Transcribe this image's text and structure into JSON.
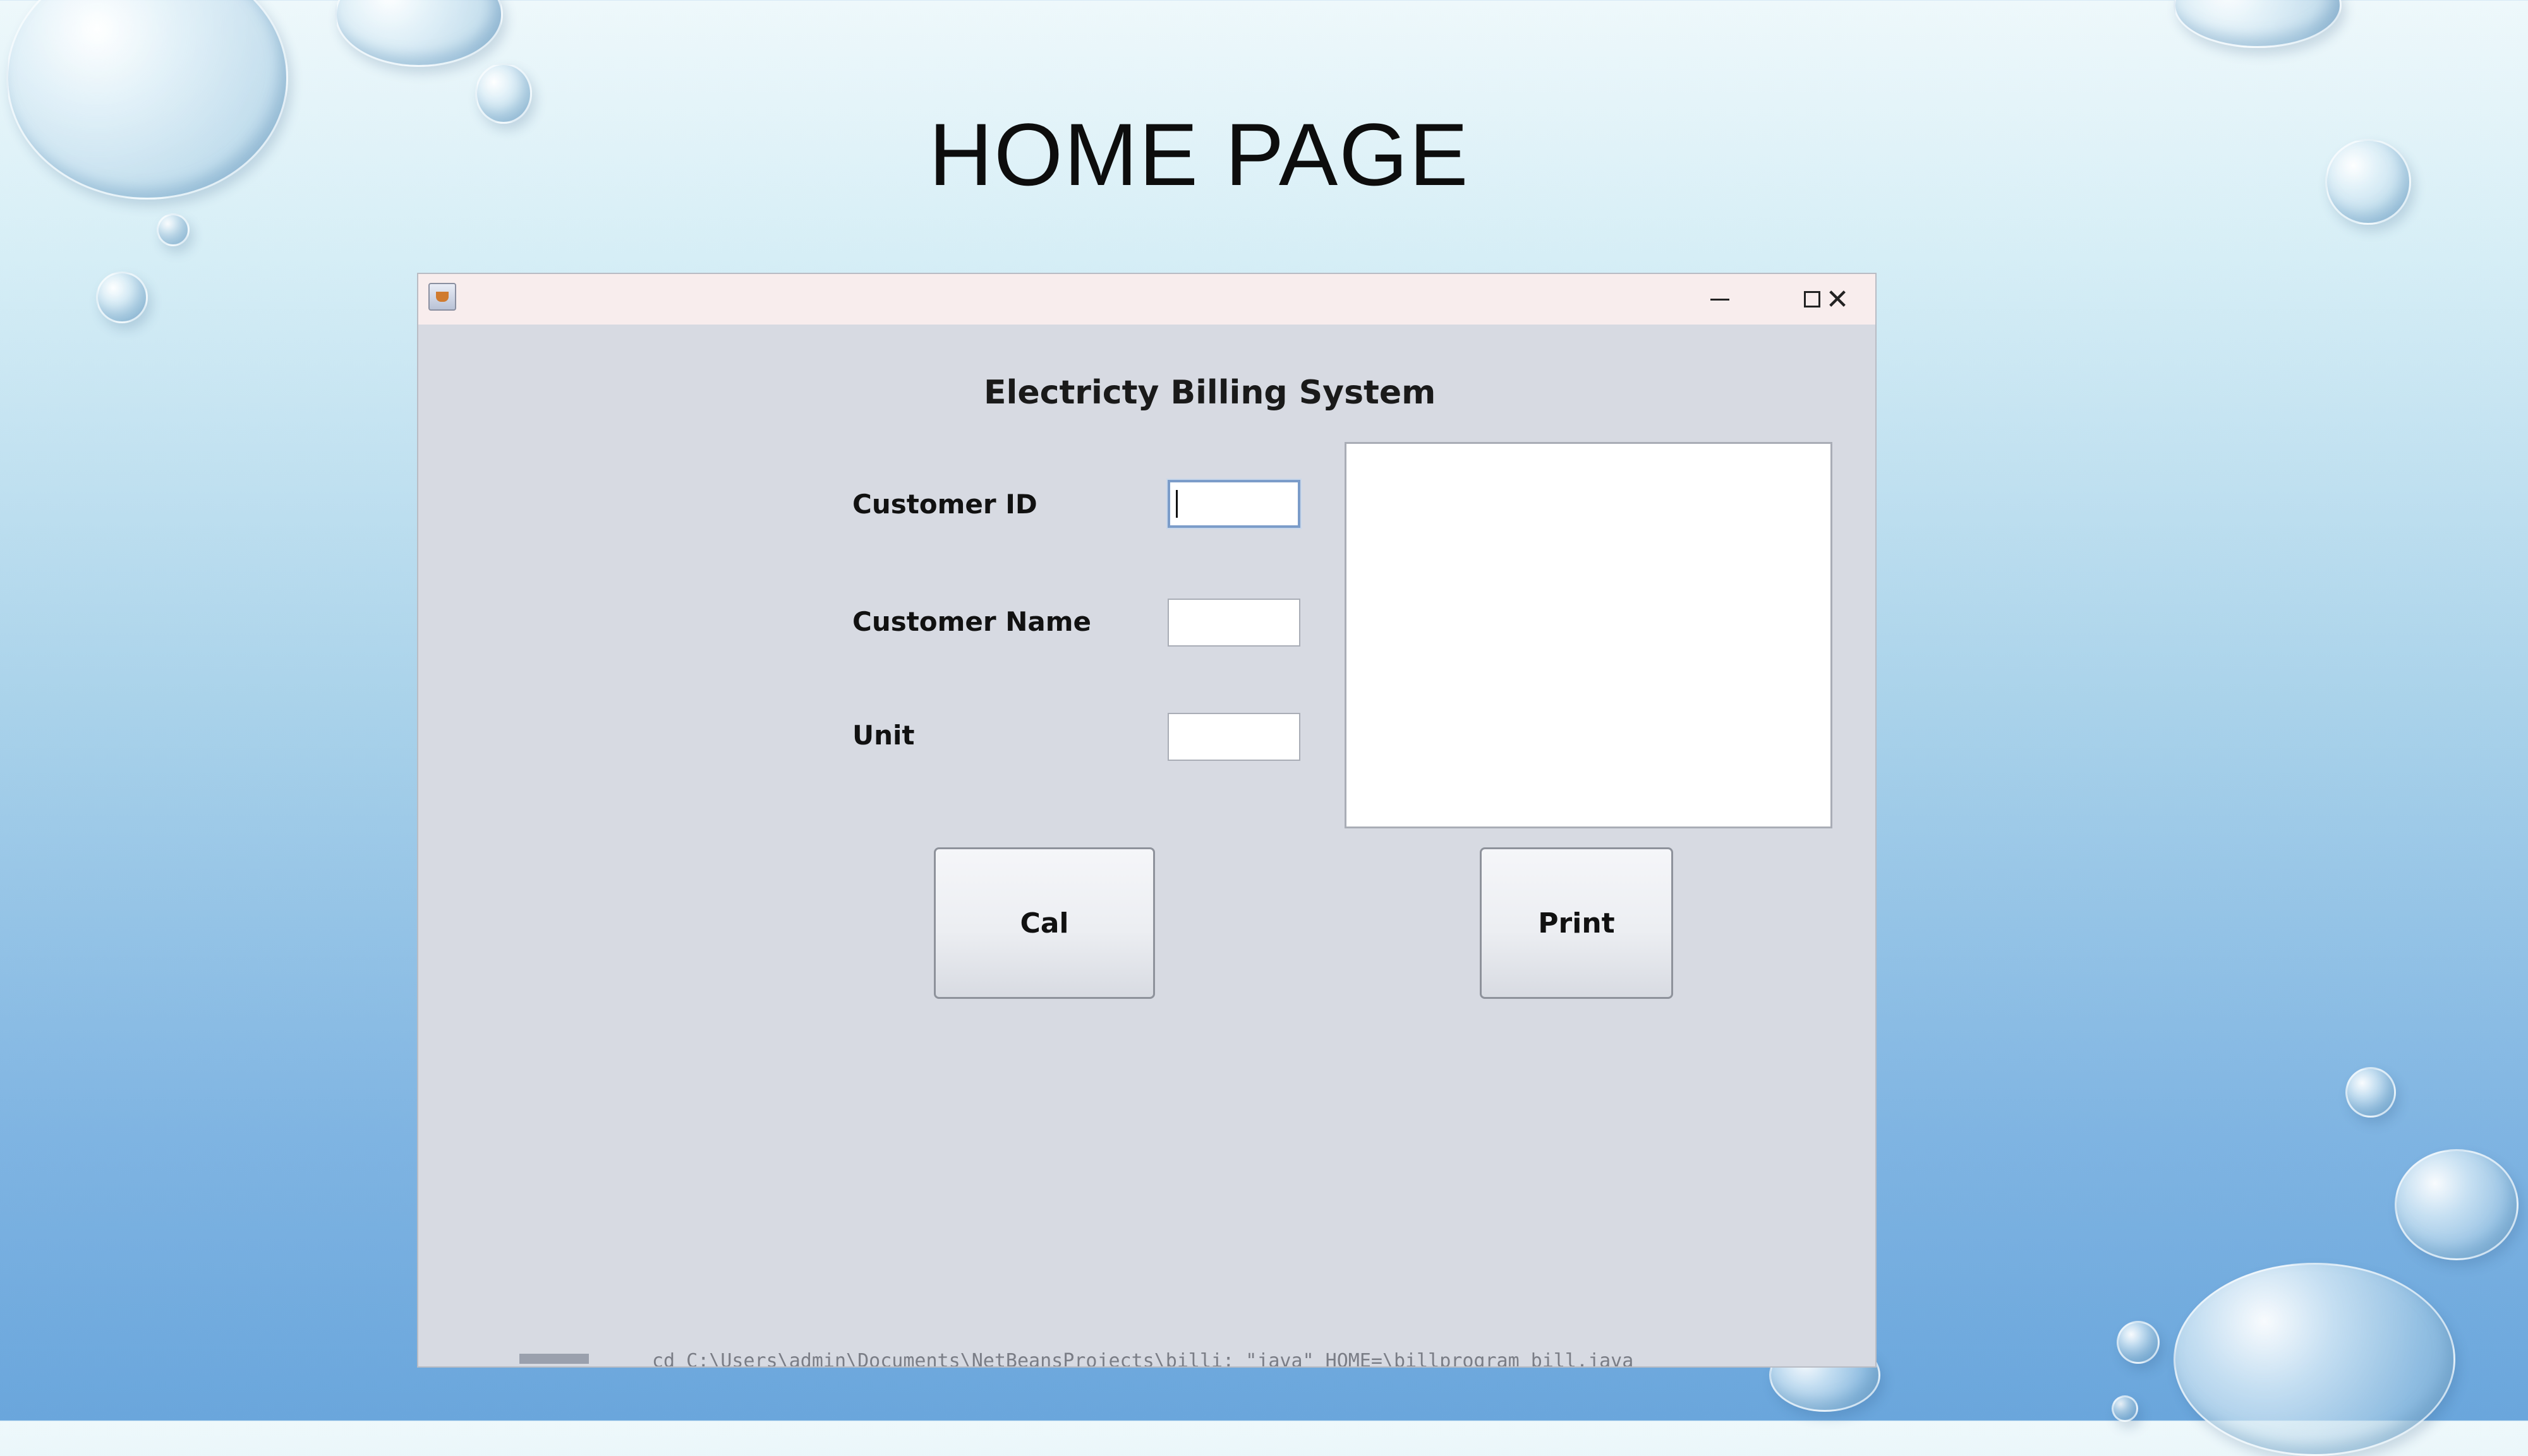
{
  "slide": {
    "title": "HOME PAGE"
  },
  "window": {
    "icon": "java-cup-icon",
    "controls": {
      "minimize_icon": "minimize-icon",
      "maximize_icon": "maximize-icon",
      "close_icon": "close-icon",
      "close_glyph": "✕"
    }
  },
  "form": {
    "title": "Electricty Billing System",
    "fields": {
      "customer_id_label": "Customer ID",
      "customer_id_value": "",
      "customer_name_label": "Customer Name",
      "customer_name_value": "",
      "unit_label": "Unit",
      "unit_value": ""
    },
    "output_text": "",
    "buttons": {
      "cal_label": "Cal",
      "print_label": "Print"
    }
  },
  "status": {
    "text": "cd C:\\Users\\admin\\Documents\\NetBeansProjects\\billi; \"java\" HOME=\\billprogram bill.java"
  },
  "colors": {
    "window_bg": "#d7dae2",
    "titlebar_bg": "#f8eded",
    "focus_border": "#7b9cc9"
  }
}
